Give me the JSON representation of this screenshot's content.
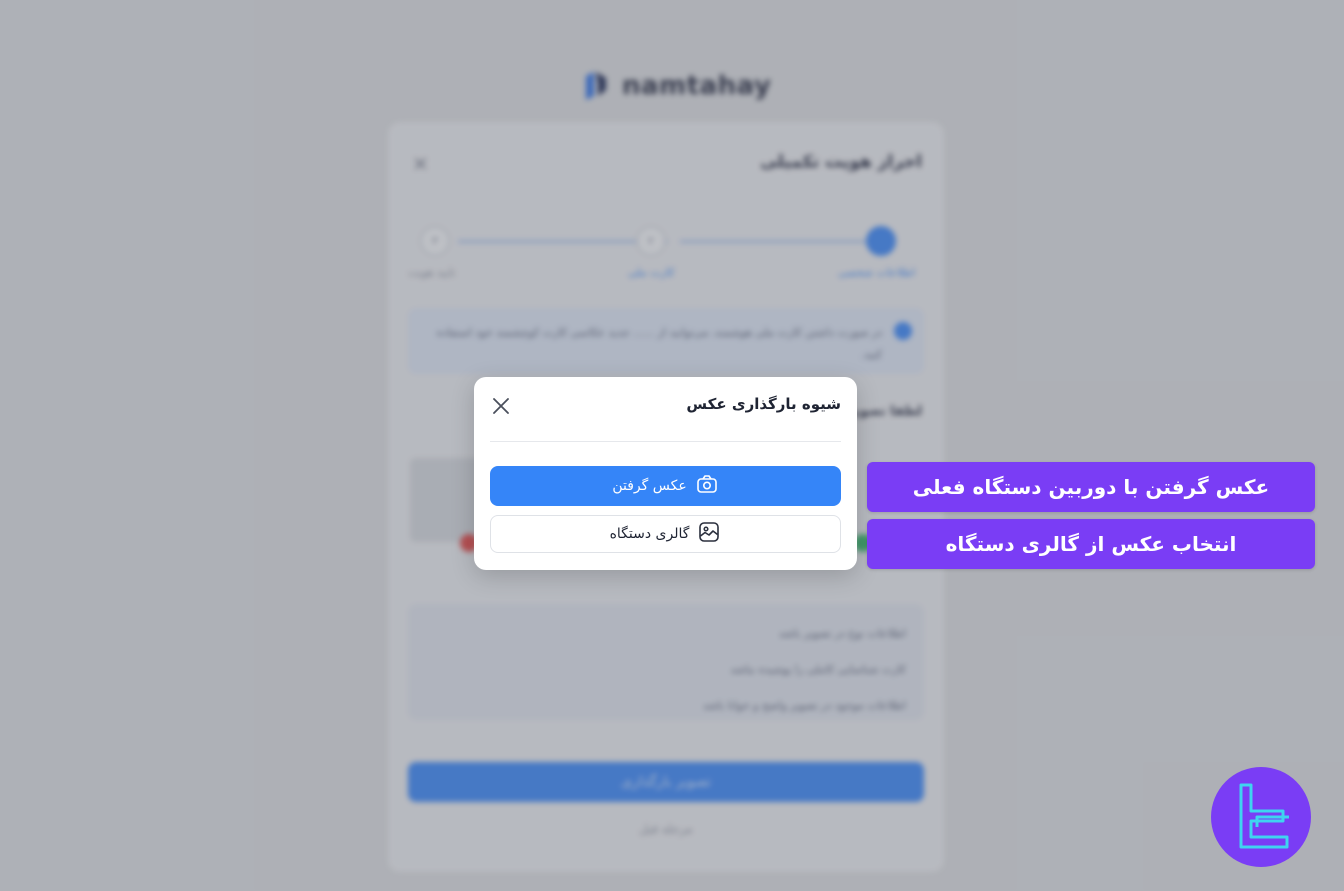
{
  "background": {
    "logo_text": "namtahay",
    "card_title": "احراز هویت تکمیلی",
    "steps": [
      {
        "number": "",
        "label": "اطلاعات شخصی"
      },
      {
        "number": "۲",
        "label": "کارت ملی"
      },
      {
        "number": "۳",
        "label": "تایید هویت"
      }
    ],
    "info_text": "در صورت داشتن کارت ملی هوشمند، می‌توانید از ...... جدید عکاسی کارت کوچشمند خود استفاده کنید.",
    "upload_label": "لطفا تصویر",
    "rules": [
      "اطلاعات نوع در تصویر باشد",
      "کارت شناسایی کاملی را پوشیده نباشد",
      "اطلاعات موجود در تصویر واضح و خوانا باشد"
    ],
    "submit_label": "تصویر بارگذاری",
    "back_label": "مرحله قبل"
  },
  "modal": {
    "title": "شیوه بارگذاری عکس",
    "camera_button_label": "عکس گرفتن",
    "gallery_button_label": "گالری دستگاه"
  },
  "annotations": {
    "camera_hint": "عکس گرفتن با دوربین دستگاه فعلی",
    "gallery_hint": "انتخاب عکس از گالری دستگاه"
  },
  "colors": {
    "primary": "#3585f8",
    "annotation": "#7a3df5",
    "badge_accent": "#3fd4f0"
  },
  "icons": [
    "close-icon",
    "camera-icon",
    "gallery-image-icon",
    "brand-logo-icon"
  ]
}
